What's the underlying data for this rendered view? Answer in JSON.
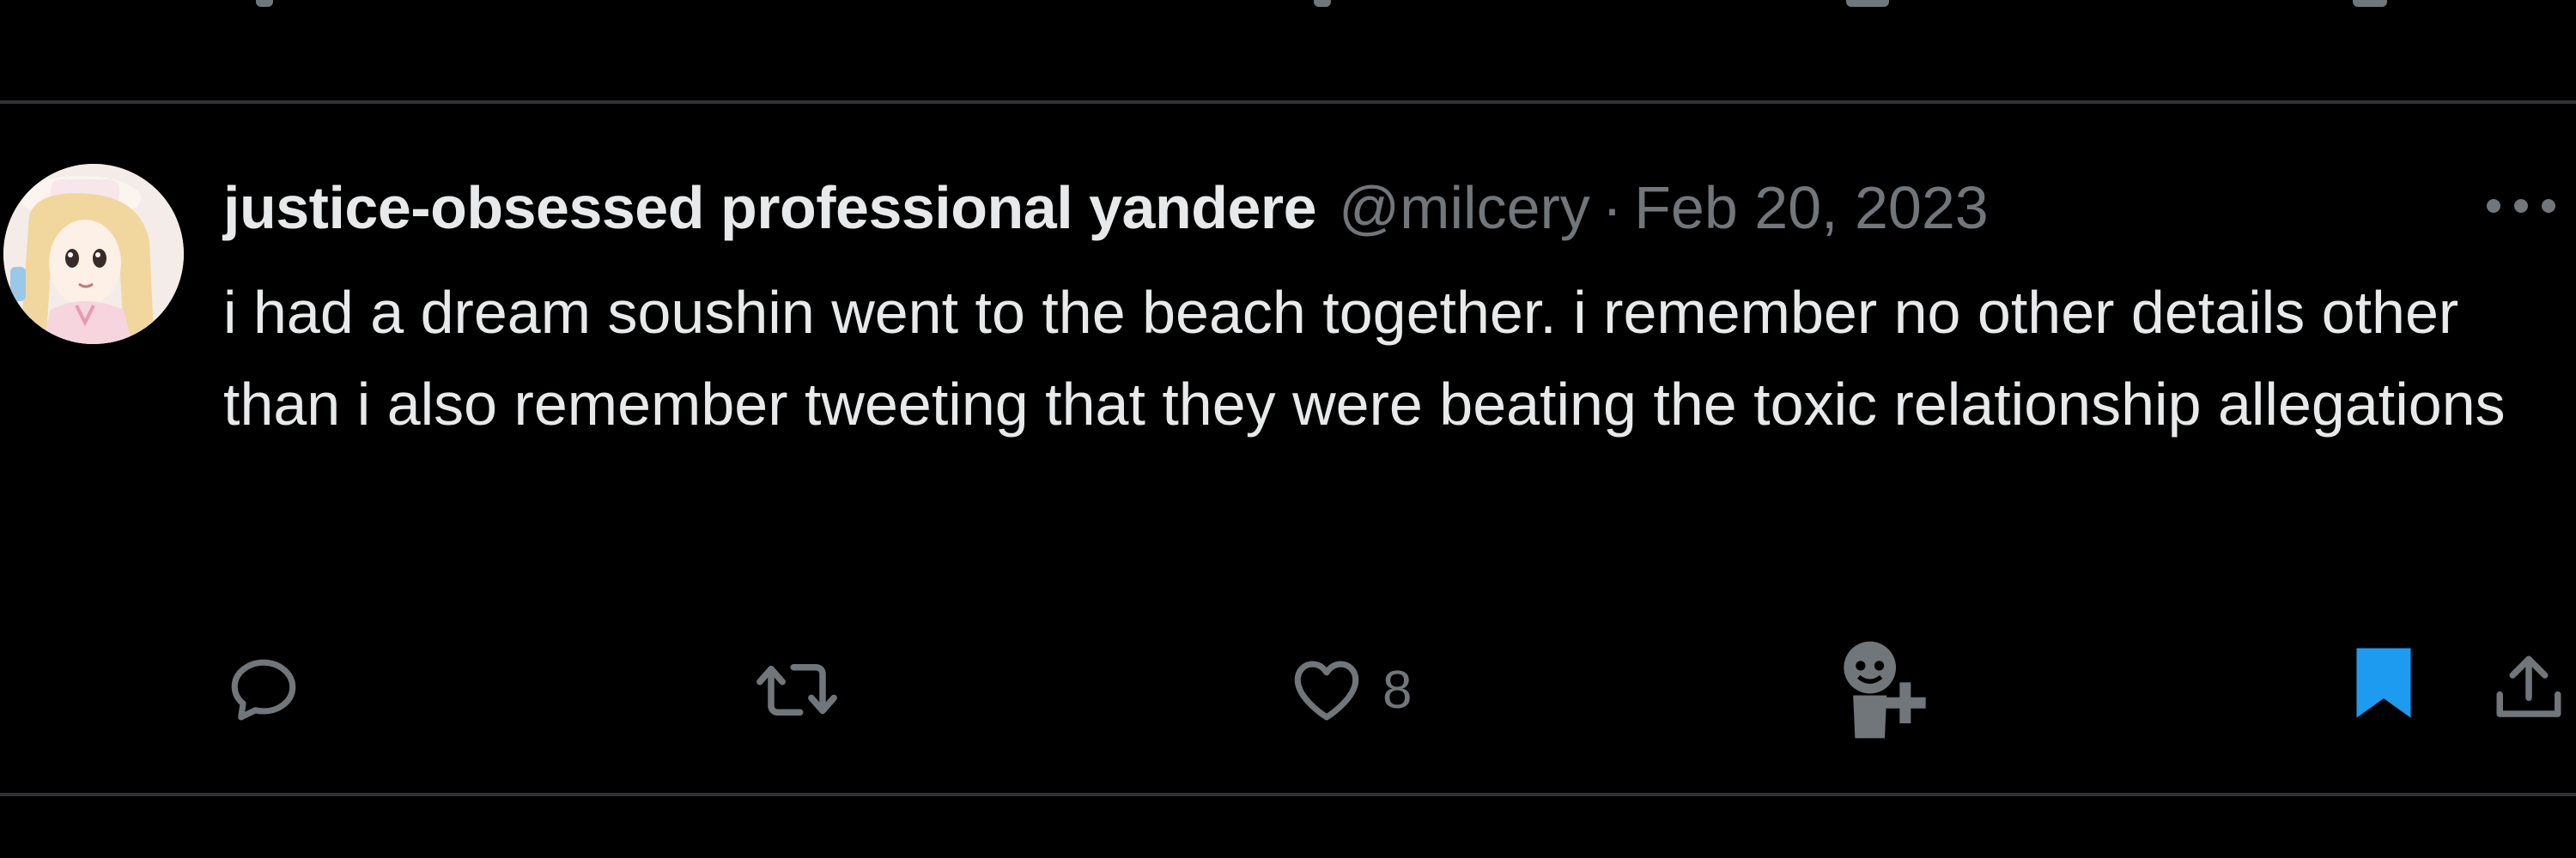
{
  "tweet": {
    "display_name": "justice-obsessed professional yandere",
    "handle": "@milcery",
    "separator": "·",
    "date": "Feb 20, 2023",
    "text": "i had a dream soushin went to the beach together. i remember no other details other than i also remember tweeting that they were beating the toxic relationship allegations",
    "actions": {
      "reply_icon": "reply-icon",
      "retweet_icon": "retweet-icon",
      "like_icon": "heart-icon",
      "like_count": "8",
      "follow_icon": "add-user-icon",
      "bookmark_icon": "bookmark-icon",
      "bookmarked": true,
      "share_icon": "share-icon"
    },
    "more_icon": "more-icon"
  },
  "colors": {
    "background": "#000000",
    "text_primary": "#e7e9ea",
    "text_secondary": "#71767b",
    "divider": "#2f3336",
    "bookmark_accent": "#1d9bf0"
  }
}
